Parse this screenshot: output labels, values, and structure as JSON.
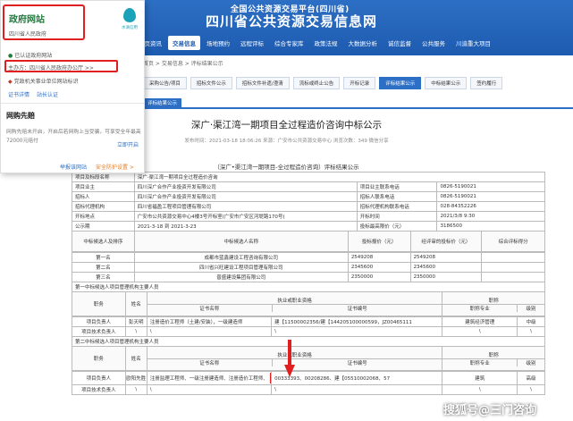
{
  "header": {
    "subtitle": "全国公共资源交易平台(四川省)",
    "title": "四川省公共资源交易信息网"
  },
  "nav": [
    "首页资讯",
    "交易信息",
    "场地预约",
    "远程评标",
    "综合专家库",
    "政策法规",
    "大数据分析",
    "诚信监督",
    "公共服务",
    "川渝重大项目"
  ],
  "nav_active_index": 1,
  "breadcrumb": "首页 > 交易信息 > 评标结果公示",
  "tabs": [
    "采购公告/项目",
    "招标文件公示",
    "招标文件补遗/澄清",
    "流标或终止公告",
    "开标记录",
    "评标结果公示",
    "中标结果公示",
    "签约履行"
  ],
  "tab_active_index": 5,
  "section_tag": "评标结果公示",
  "document": {
    "title": "深广·渠江湾一期项目全过程造价咨询中标公示",
    "meta": "发布时间：2021-03-18 18:06:26   来源：广安市公共资源交易中心   浏览次数：349   微信分享",
    "result_title": "（深广•渠江湾一期项目-全过程造价咨询）评标结果公示"
  },
  "table": {
    "info_rows": [
      [
        "项目及标段名称",
        "深广·渠江湾一期项目全过程造价咨询",
        "",
        ""
      ],
      [
        "项目业主",
        "四川深广合作产业投资开发有限公司",
        "项目业主联系电话",
        "0826-5190021"
      ],
      [
        "招标人",
        "四川深广合作产业投资开发有限公司",
        "招标人联系电话",
        "0826-5190021"
      ],
      [
        "招标代理机构",
        "四川省福盈工程项目管理有限公司",
        "招标代理机构联系电话",
        "028-84352226"
      ],
      [
        "开标地点",
        "广安市公共资源交易中心4楼3号开标室(广安市广安区河堤路170号)",
        "开标时间",
        "2021/3/8 9:30"
      ],
      [
        "公示期",
        "2021-3-18 到 2021-3-23",
        "投标最高限价（元）",
        "3186500"
      ]
    ],
    "candidate_head": [
      "中标候选人及排序",
      "中标候选人名称",
      "投标报价（元）",
      "经评审的投标价（元）",
      "综合评标得分"
    ],
    "candidates": [
      [
        "第一名",
        "成都市蓝鑫建设工程咨询有限公司",
        "2549208",
        "2549208",
        ""
      ],
      [
        "第二名",
        "四川省兴旺建设工程项目管理有限公司",
        "2345600",
        "2345600",
        ""
      ],
      [
        "第三名",
        "普盛建设集团有限公司",
        "2350000",
        "2350000",
        ""
      ]
    ],
    "first_section": "第一中标候选人项目管理机构主要人员",
    "staff_head": [
      "职务",
      "姓名",
      "执业或职业资格",
      "证书名称",
      "证书编号",
      "职称",
      "职称专业",
      "级别"
    ],
    "first_staff": [
      [
        "项目负责人",
        "彭天明",
        "注册造价工程师（土建/安装），一级建造师",
        "建【11500002356/建【144205100000599，JZ00465111",
        "建筑经济管理",
        "中级"
      ],
      [
        "项目技术负责人",
        "\\",
        "\\",
        "\\",
        "\\",
        "\\"
      ]
    ],
    "second_section": "第二中标候选人项目管理机构主要人员",
    "second_staff": [
      [
        "项目负责人",
        "欧阳先胜",
        "注册监理工程师、一级注册建造师、注册造价工程师、",
        "全过程工程咨询师",
        "00333393、00208286、建【05510002068、57",
        "建筑",
        "高级"
      ],
      [
        "项目技术负责人",
        "\\",
        "\\",
        "",
        "\\",
        "\\",
        "\\"
      ]
    ]
  },
  "popup": {
    "site_title": "政府网站",
    "site_org": "四川省人民政府",
    "logo_text": "水滴信用",
    "verified": "已认证政府网站",
    "host": "主办方：四川省人民政府办公厅 >>",
    "party_flag": "党政机关事业单位网站标识",
    "links": [
      "证书详情",
      "站长认证"
    ],
    "section_title": "网购先赔",
    "section_desc": "网购先赔未开启，开启后若网购上当受骗，可享受全年最高72000元赔付",
    "section_link": "立即开启",
    "footer_links": [
      "举报该网站",
      "安全防护设置 >"
    ]
  },
  "watermark": "搜狐号@三门咨询",
  "colors": {
    "primary": "#2d6fc4",
    "highlight_red": "#e02020",
    "highlight_yellow": "#ffd400",
    "green": "#1f7a3a"
  }
}
